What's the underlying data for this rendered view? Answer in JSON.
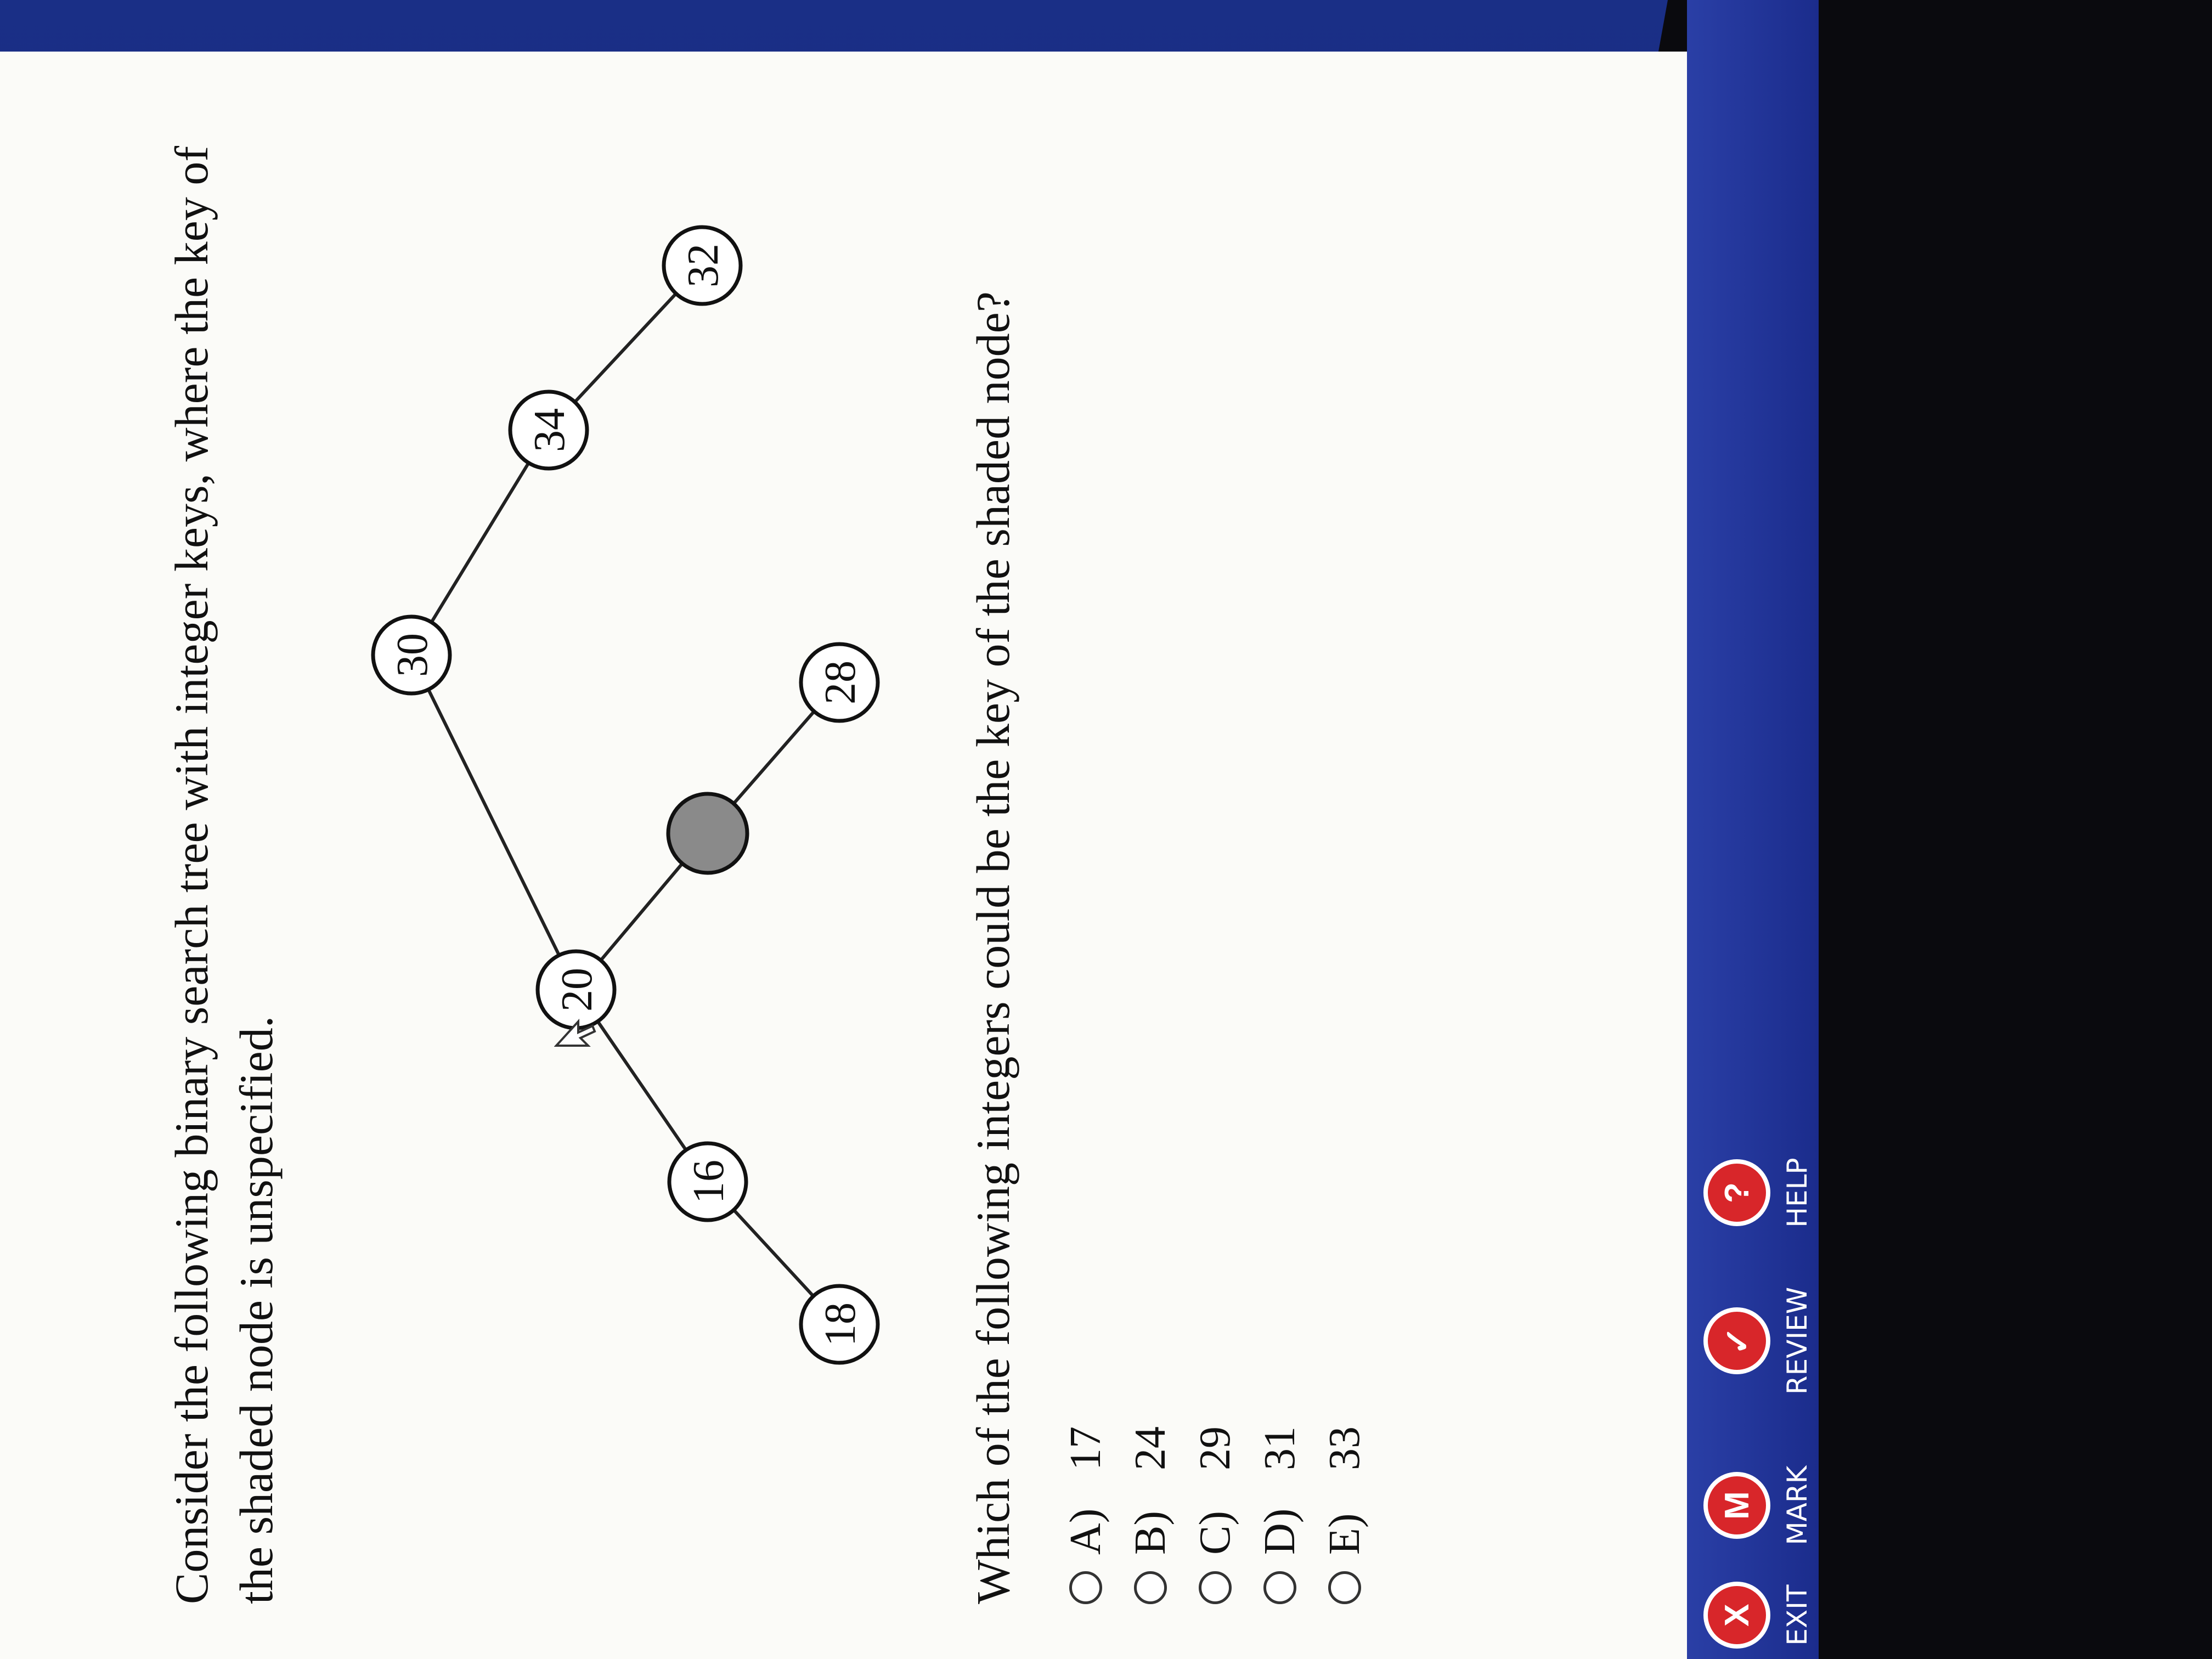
{
  "prompt": "Consider the following binary search tree with integer keys, where the key of the shaded node is unspecified.",
  "tree": {
    "nodes": [
      {
        "key": "30",
        "shaded": false
      },
      {
        "key": "20",
        "shaded": false
      },
      {
        "key": "34",
        "shaded": false
      },
      {
        "key": "16",
        "shaded": false
      },
      {
        "key": "",
        "shaded": true
      },
      {
        "key": "32",
        "shaded": false
      },
      {
        "key": "18",
        "shaded": false
      },
      {
        "key": "28",
        "shaded": false
      }
    ],
    "edges": [
      [
        "30",
        "20"
      ],
      [
        "30",
        "34"
      ],
      [
        "20",
        "16"
      ],
      [
        "20",
        "shaded"
      ],
      [
        "34",
        "32"
      ],
      [
        "16",
        "18"
      ],
      [
        "shaded",
        "28"
      ]
    ]
  },
  "question": "Which of the following integers could be the key of the shaded node?",
  "choices": [
    {
      "label": "A)",
      "value": "17"
    },
    {
      "label": "B)",
      "value": "24"
    },
    {
      "label": "C)",
      "value": "29"
    },
    {
      "label": "D)",
      "value": "31"
    },
    {
      "label": "E)",
      "value": "33"
    }
  ],
  "toolbar": {
    "exit": {
      "icon": "X",
      "label": "EXIT"
    },
    "mark": {
      "icon": "M",
      "label": "MARK"
    },
    "review": {
      "icon": "✓",
      "label": "REVIEW"
    },
    "help": {
      "icon": "?",
      "label": "HELP"
    }
  },
  "colors": {
    "frame_blue": "#1b2c8c",
    "exit_red": "#d8262a",
    "mark_red": "#d8262a",
    "review_red": "#d8262a",
    "help_red": "#d8262a",
    "shaded_node": "#8a8a8a"
  }
}
